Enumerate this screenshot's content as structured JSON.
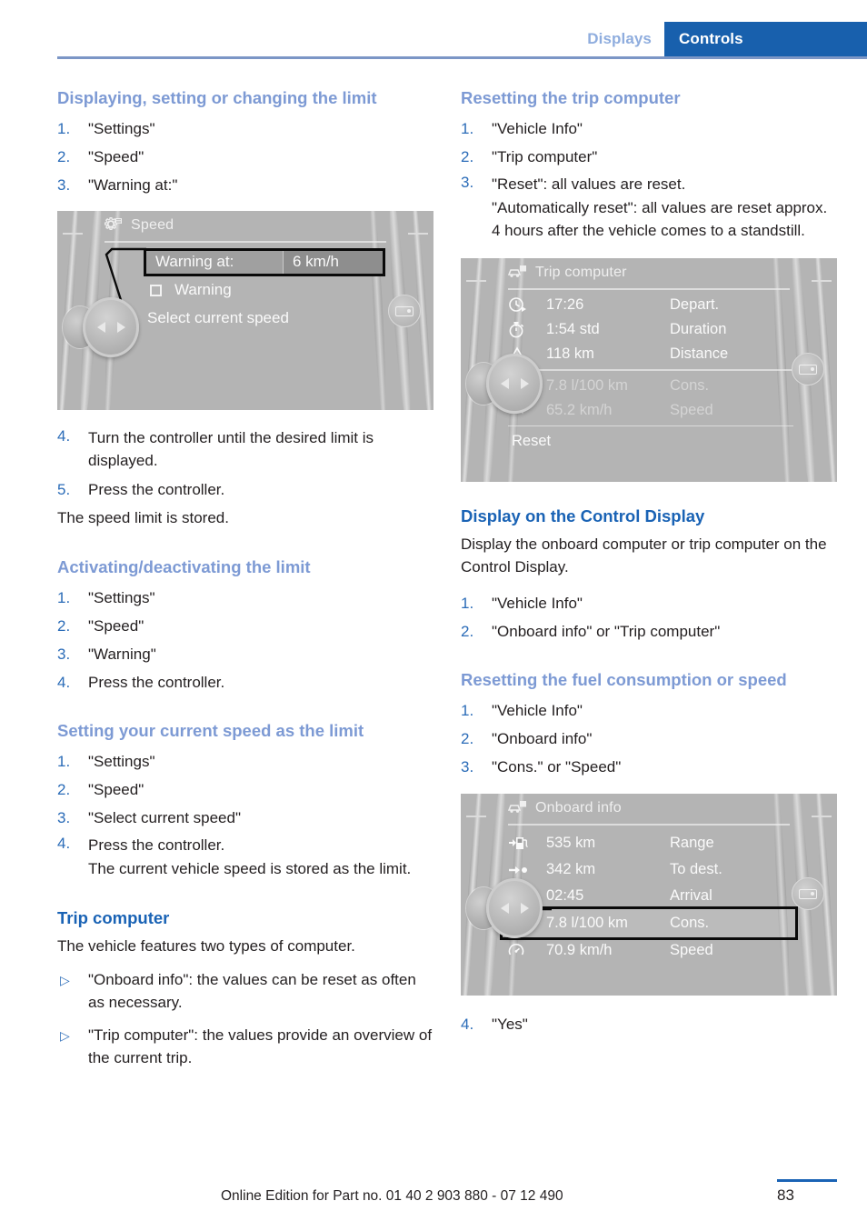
{
  "header": {
    "tab_inactive": "Displays",
    "tab_active": "Controls",
    "accent_blue": "#1860ad",
    "heading_blue": "#7d9ad4"
  },
  "left_column": {
    "section1": {
      "heading": "Displaying, setting or changing the limit",
      "steps": [
        "\"Settings\"",
        "\"Speed\"",
        "\"Warning at:\""
      ]
    },
    "image1": {
      "title": "Speed",
      "title_icon": "settings-gear-icon",
      "kv_key": "Warning at:",
      "kv_value": "6 km/h",
      "checkbox_label": "Warning",
      "option_label": "Select current speed",
      "knob_icon": "controller-knob-icon",
      "side_button_icon": "display-back-icon"
    },
    "steps_after_image": [
      "Turn the controller until the desired limit is displayed.",
      "Press the controller."
    ],
    "steps_after_image_start": 4,
    "closing_note": "The speed limit is stored.",
    "section2": {
      "heading": "Activating/deactivating the limit",
      "steps": [
        "\"Settings\"",
        "\"Speed\"",
        "\"Warning\"",
        "Press the controller."
      ]
    },
    "section3": {
      "heading": "Setting your current speed as the limit",
      "steps": [
        "\"Settings\"",
        "\"Speed\"",
        "\"Select current speed\"",
        "Press the controller."
      ],
      "step4_sub": "The current vehicle speed is stored as the limit."
    },
    "section4": {
      "heading": "Trip computer",
      "intro": "The vehicle features two types of computer.",
      "bullets": [
        "\"Onboard info\": the values can be reset as often as necessary.",
        "\"Trip computer\": the values provide an overview of the current trip."
      ]
    }
  },
  "right_column": {
    "section1": {
      "heading": "Resetting the trip computer",
      "steps": [
        "\"Vehicle Info\"",
        "\"Trip computer\"",
        "\"Reset\": all values are reset."
      ],
      "step3_sub": "\"Automatically reset\": all values are reset approx. 4 hours after the vehicle comes to a standstill."
    },
    "image2": {
      "title": "Trip computer",
      "title_icon": "vehicle-info-icon",
      "rows": [
        {
          "icon": "depart-clock-icon",
          "value": "17:26",
          "label": "Depart.",
          "dim": false
        },
        {
          "icon": "stopwatch-icon",
          "value": "1:54 std",
          "label": "Duration",
          "dim": false
        },
        {
          "icon": "distance-road-icon",
          "value": "118 km",
          "label": "Distance",
          "dim": false
        },
        {
          "icon": "fuel-pump-icon",
          "value": "7.8 l/100 km",
          "label": "Cons.",
          "dim": true
        },
        {
          "icon": "speedometer-icon",
          "value": "65.2 km/h",
          "label": "Speed",
          "dim": true
        }
      ],
      "reset_label": "Reset",
      "knob_icon": "controller-knob-icon",
      "side_button_icon": "display-back-icon"
    },
    "section2": {
      "heading": "Display on the Control Display",
      "intro": "Display the onboard computer or trip computer on the Control Display.",
      "steps": [
        "\"Vehicle Info\"",
        "\"Onboard info\" or \"Trip computer\""
      ]
    },
    "section3": {
      "heading": "Resetting the fuel consumption or speed",
      "steps": [
        "\"Vehicle Info\"",
        "\"Onboard info\"",
        "\"Cons.\" or \"Speed\""
      ]
    },
    "image3": {
      "title": "Onboard info",
      "title_icon": "vehicle-info-icon",
      "rows": [
        {
          "icon": "range-fuel-icon",
          "value": "535 km",
          "label": "Range",
          "highlight": false
        },
        {
          "icon": "to-destination-icon",
          "value": "342 km",
          "label": "To dest.",
          "highlight": false
        },
        {
          "icon": "arrival-clock-icon",
          "value": "02:45",
          "label": "Arrival",
          "highlight": false
        },
        {
          "icon": "fuel-pump-icon",
          "value": "7.8 l/100 km",
          "label": "Cons.",
          "highlight": true
        },
        {
          "icon": "speedometer-icon",
          "value": "70.9 km/h",
          "label": "Speed",
          "highlight": false
        }
      ],
      "knob_icon": "controller-knob-icon",
      "side_button_icon": "display-back-icon"
    },
    "final_step": {
      "num": "4.",
      "text": "\"Yes\""
    }
  },
  "footer": {
    "edition_text": "Online Edition for Part no. 01 40 2 903 880 - 07 12 490",
    "page_number": "83"
  }
}
